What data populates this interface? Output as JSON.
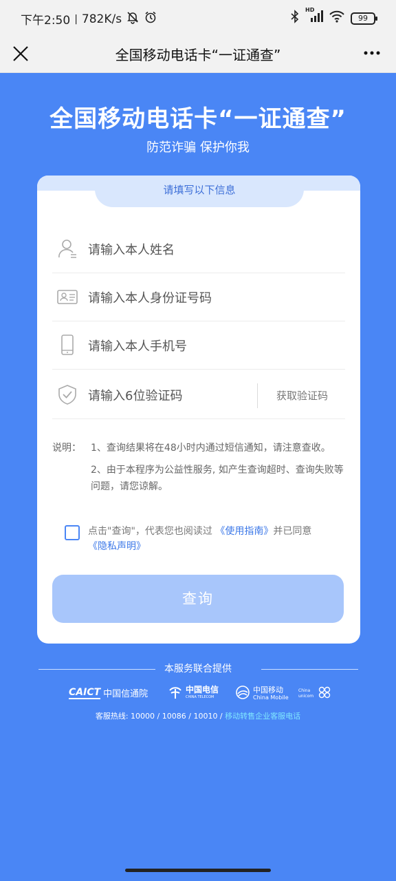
{
  "status": {
    "time": "下午2:50",
    "speed": "782K/s",
    "battery": "99",
    "hd": "HD"
  },
  "titlebar": {
    "title": "全国移动电话卡“一证通查”",
    "close_icon": "close-icon",
    "more_icon": "more-icon"
  },
  "hero": {
    "title": "全国移动电话卡“一证通查”",
    "subtitle": "防范诈骗 保护你我"
  },
  "form": {
    "header": "请填写以下信息",
    "fields": [
      {
        "placeholder": "请输入本人姓名",
        "icon": "user-icon"
      },
      {
        "placeholder": "请输入本人身份证号码",
        "icon": "id-card-icon"
      },
      {
        "placeholder": "请输入本人手机号",
        "icon": "phone-icon"
      },
      {
        "placeholder": "请输入6位验证码",
        "icon": "shield-icon"
      }
    ],
    "code_button": "获取验证码"
  },
  "notes": {
    "label": "说明：",
    "items": [
      "1、查询结果将在48小时内通过短信通知，请注意查收。",
      "2、由于本程序为公益性服务, 如产生查询超时、查询失败等问题，请您谅解。"
    ]
  },
  "agreement": {
    "prefix": "点击\"查询\"，代表您也阅读过 ",
    "guide_link": "《使用指南》",
    "middle": "并已同意",
    "privacy_link": "《隐私声明》"
  },
  "query_button": "查询",
  "footer": {
    "provided_by": "本服务联合提供",
    "logos": {
      "caict_abbr": "CAICT",
      "caict_name": "中国信通院",
      "telecom_cn": "中国电信",
      "telecom_en": "CHINA TELECOM",
      "mobile_cn": "中国移动",
      "mobile_en": "China Mobile",
      "unicom_en": "China unicom"
    },
    "hotline_text": "客服热线: 10000 / 10086 / 10010 / ",
    "hotline_link": "移动转售企业客服电话"
  },
  "colors": {
    "background": "#4a86f5",
    "button": "#a8c6fb",
    "tab": "#d9e7fd",
    "link": "#3c78e8"
  }
}
